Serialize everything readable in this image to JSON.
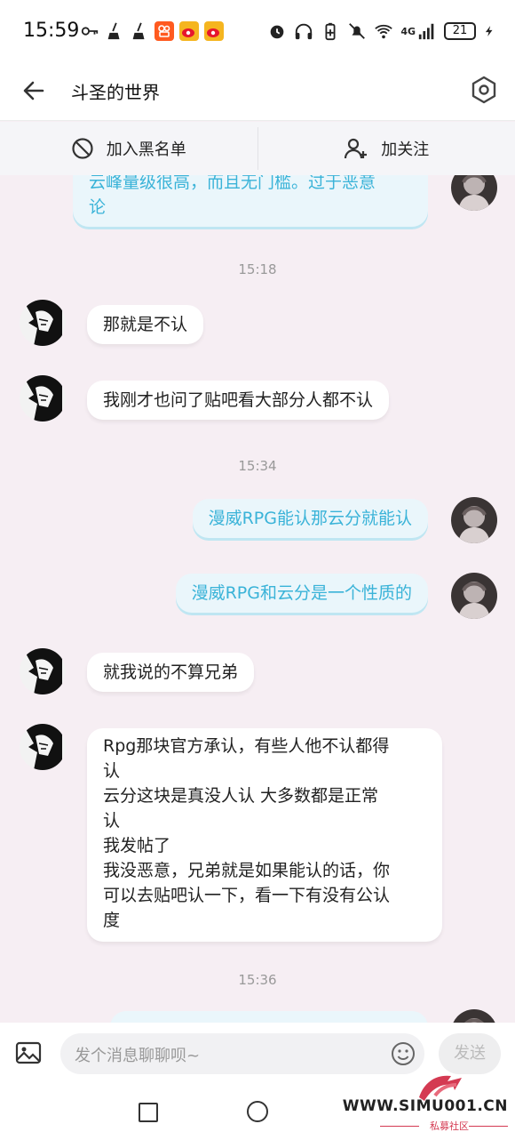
{
  "status_bar": {
    "time": "15:59",
    "network": "4G",
    "battery": "21",
    "app_icons": [
      "key-icon",
      "broom-icon",
      "broom-icon",
      "kuaishou-icon",
      "weibo-icon",
      "weibo-icon"
    ],
    "system_icons": [
      "alarm-icon",
      "headphones-icon",
      "battery-saver-icon",
      "mute-icon",
      "wifi-icon",
      "signal-icon",
      "charging-icon"
    ]
  },
  "header": {
    "title": "斗圣的世界"
  },
  "actions": {
    "block_label": "加入黑名单",
    "follow_label": "加关注"
  },
  "messages": {
    "m0": {
      "side": "out",
      "text": "云峰量级很高，而且无门槛。过于恶意\n论"
    },
    "t1": "15:18",
    "m1": {
      "side": "in",
      "text": "那就是不认"
    },
    "m2": {
      "side": "in",
      "text": "我刚才也问了贴吧看大部分人都不认"
    },
    "t2": "15:34",
    "m3": {
      "side": "out",
      "text": "漫威RPG能认那云分就能认"
    },
    "m4": {
      "side": "out",
      "text": "漫威RPG和云分是一个性质的"
    },
    "m5": {
      "side": "in",
      "text": "就我说的不算兄弟"
    },
    "m6": {
      "side": "in",
      "text": "Rpg那块官方承认，有些人他不认都得\n认\n云分这块是真没人认 大多数都是正常\n认\n我发帖了\n我没恶意，兄弟就是如果能认的话，你\n可以去贴吧认一下，看一下有没有公认\n度"
    },
    "t3": "15:36"
  },
  "input": {
    "placeholder": "发个消息聊聊呗~",
    "send_label": "发送"
  },
  "watermark": {
    "site": "WWW.SIMU001.CN",
    "sub": "私募社区"
  },
  "colors": {
    "chat_bg": "#f6eef3",
    "out_bubble_bg": "#eaf6fb",
    "out_bubble_text": "#3ab3d8",
    "in_bubble_bg": "#ffffff",
    "watermark_red": "#d43a52"
  }
}
